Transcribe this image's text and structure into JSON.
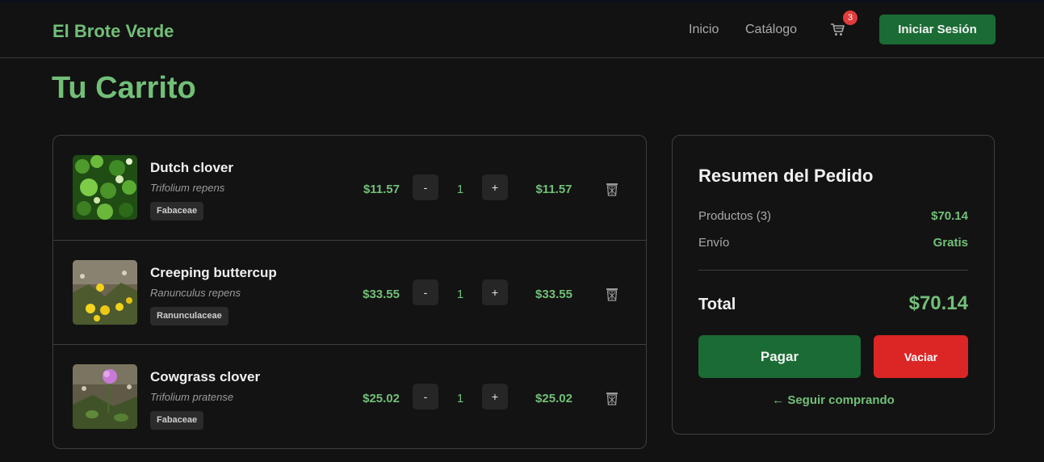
{
  "header": {
    "brand": "El Brote Verde",
    "nav": {
      "inicio": "Inicio",
      "catalogo": "Catálogo"
    },
    "cart_icon": "shopping-cart-icon",
    "cart_count": "3",
    "login_label": "Iniciar Sesión"
  },
  "page": {
    "title": "Tu Carrito"
  },
  "cart": {
    "items": [
      {
        "name": "Dutch clover",
        "scientific": "Trifolium repens",
        "family": "Fabaceae",
        "price": "$11.57",
        "quantity": "1",
        "total": "$11.57",
        "minus": "-",
        "plus": "+",
        "image": "clover-photo",
        "delete_icon": "trash-icon"
      },
      {
        "name": "Creeping buttercup",
        "scientific": "Ranunculus repens",
        "family": "Ranunculaceae",
        "price": "$33.55",
        "quantity": "1",
        "total": "$33.55",
        "minus": "-",
        "plus": "+",
        "image": "buttercup-photo",
        "delete_icon": "trash-icon"
      },
      {
        "name": "Cowgrass clover",
        "scientific": "Trifolium pratense",
        "family": "Fabaceae",
        "price": "$25.02",
        "quantity": "1",
        "total": "$25.02",
        "minus": "-",
        "plus": "+",
        "image": "red-clover-photo",
        "delete_icon": "trash-icon"
      }
    ]
  },
  "summary": {
    "title": "Resumen del Pedido",
    "products_label": "Productos (3)",
    "products_value": "$70.14",
    "shipping_label": "Envío",
    "shipping_value": "Gratis",
    "total_label": "Total",
    "total_value": "$70.14",
    "pay_label": "Pagar",
    "empty_label": "Vaciar",
    "continue_label": "← Seguir comprando"
  },
  "colors": {
    "accent": "#72bf78",
    "primary_button": "#1b6b35",
    "danger": "#dc2626",
    "background": "#121212"
  }
}
